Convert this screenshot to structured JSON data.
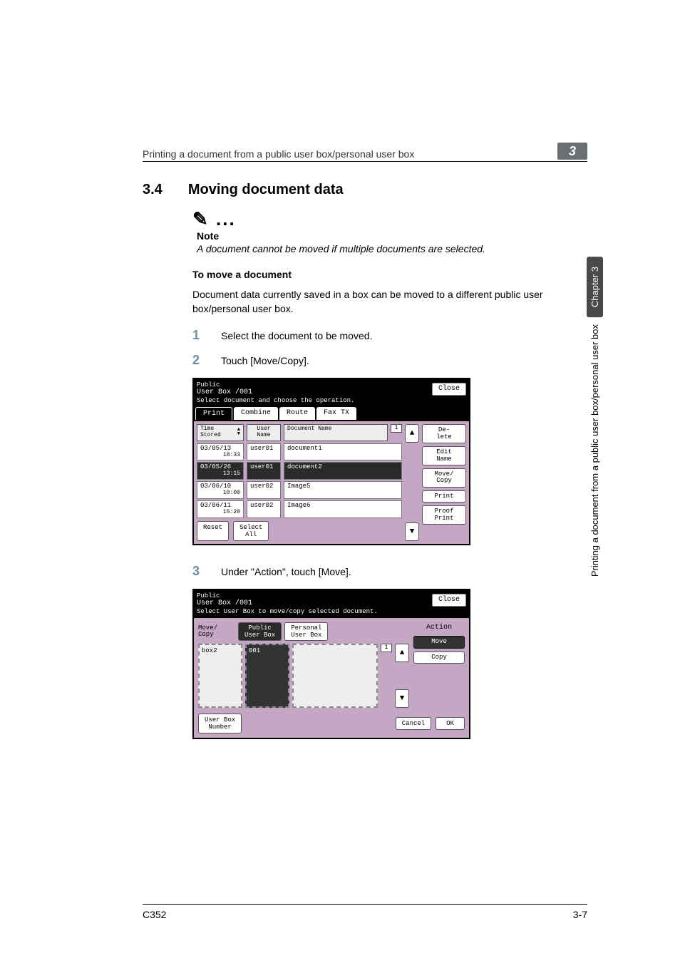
{
  "header": {
    "breadcrumb": "Printing a document from a public user box/personal user box",
    "chapter_badge": "3"
  },
  "side_tab": {
    "chapter": "Chapter 3",
    "long_label": "Printing a document from a public user box/personal user box"
  },
  "section": {
    "num": "3.4",
    "title": "Moving document data"
  },
  "note": {
    "icon": "✎ ...",
    "label": "Note",
    "text": "A document cannot be moved if multiple documents are selected."
  },
  "sub_heading": "To move a document",
  "intro": "Document data currently saved in a box can be moved to a different public user box/personal user box.",
  "steps": [
    {
      "num": "1",
      "text": "Select the document to be moved."
    },
    {
      "num": "2",
      "text": "Touch [Move/Copy]."
    },
    {
      "num": "3",
      "text": "Under \"Action\", touch [Move]."
    }
  ],
  "panel1": {
    "title_line1": "Public",
    "title_line2": "User Box   /001",
    "instruction": "Select document and choose the operation.",
    "close": "Close",
    "tabs": [
      "Print",
      "Combine",
      "Route",
      "Fax TX"
    ],
    "thead": {
      "time": "Time Stored",
      "user": "User Name",
      "doc": "Document Name"
    },
    "page_num": "1",
    "rows": [
      {
        "time": "03/05/13",
        "time2": "18:33",
        "user": "user01",
        "doc": "document1",
        "selected": false
      },
      {
        "time": "03/05/26",
        "time2": "13:15",
        "user": "user01",
        "doc": "document2",
        "selected": true
      },
      {
        "time": "03/06/10",
        "time2": "10:00",
        "user": "user02",
        "doc": "Image5",
        "selected": false
      },
      {
        "time": "03/06/11",
        "time2": "15:20",
        "user": "user02",
        "doc": "Image6",
        "selected": false
      }
    ],
    "side_buttons": [
      "De-\nlete",
      "Edit\nName",
      "Move/\nCopy",
      "Print",
      "Proof\nPrint"
    ],
    "bottom": {
      "reset": "Reset",
      "select_all": "Select\nAll"
    },
    "arrows": {
      "up": "▲",
      "down": "▼"
    }
  },
  "panel2": {
    "title_line1": "Public",
    "title_line2": "User Box   /001",
    "instruction": "Select User Box to move/copy selected document.",
    "close": "Close",
    "move_label": "Move/\nCopy",
    "tabs": [
      "Public\nUser Box",
      "Personal\nUser Box"
    ],
    "left_col_header": "box2",
    "right_col_header": "001",
    "page_num": "1",
    "action_header": "Action",
    "action_buttons": [
      "Move",
      "Copy"
    ],
    "bottom": {
      "userbox": "User Box\nNumber",
      "cancel": "Cancel",
      "ok": "OK"
    },
    "arrows": {
      "up": "▲",
      "down": "▼"
    }
  },
  "footer": {
    "left": "C352",
    "right": "3-7"
  }
}
